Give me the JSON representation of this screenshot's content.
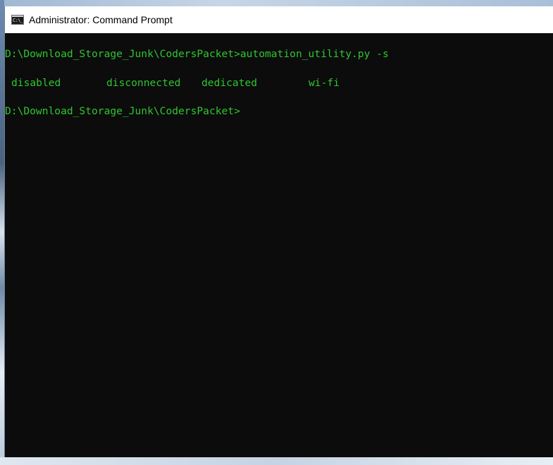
{
  "window": {
    "title": "Administrator: Command Prompt",
    "icon": "cmd-icon",
    "icon_text": "C:\\_"
  },
  "console": {
    "command_line": {
      "prompt": "D:\\Download_Storage_Junk\\CodersPacket>",
      "command": "automation_utility.py -s"
    },
    "output_row": [
      "disabled",
      "disconnected",
      "dedicated",
      "wi-fi"
    ],
    "current_prompt": "D:\\Download_Storage_Junk\\CodersPacket>"
  },
  "colors": {
    "console_background": "#0c0c0c",
    "console_text": "#2fc52f",
    "titlebar_background": "#ffffff"
  }
}
